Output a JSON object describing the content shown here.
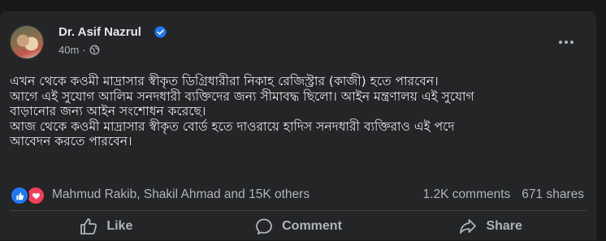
{
  "post": {
    "author": "Dr. Asif Nazrul",
    "time": "40m",
    "text_lines": [
      "এখন থেকে কওমী মাদ্রাসার স্বীকৃত ডিগ্রিধারীরা নিকাহ রেজিস্ট্রার (কাজী) হতে পারবেন।",
      "আগে এই সুযোগ আলিম সনদধারী ব্যক্তিদের জন্য সীমাবদ্ধ ছিলো। আইন মন্ত্রণালয় এই সুযোগ",
      "বাড়ানোর জন্য আইন সংশোধন করেছে।",
      "আজ থেকে কওমী মাদ্রাসার স্বীকৃত বোর্ড হতে দাওরায়ে হাদিস সনদধারী ব্যক্তিরাও এই পদে",
      "আবেদন করতে পারবেন।"
    ]
  },
  "reactions": {
    "names": "Mahmud Rakib, Shakil Ahmad and 15K others",
    "comments": "1.2K comments",
    "shares": "671 shares"
  },
  "actions": {
    "like": "Like",
    "comment": "Comment",
    "share": "Share"
  },
  "icons": [
    "verified-badge-icon",
    "globe-icon",
    "more-options-icon",
    "like-reaction-icon",
    "love-reaction-icon",
    "like-icon",
    "comment-icon",
    "share-icon"
  ],
  "colors": {
    "background": "#18191a",
    "card": "#242526",
    "accent": "#2078f4",
    "love": "#f33e58",
    "secondary_text": "#b0b3b8"
  }
}
